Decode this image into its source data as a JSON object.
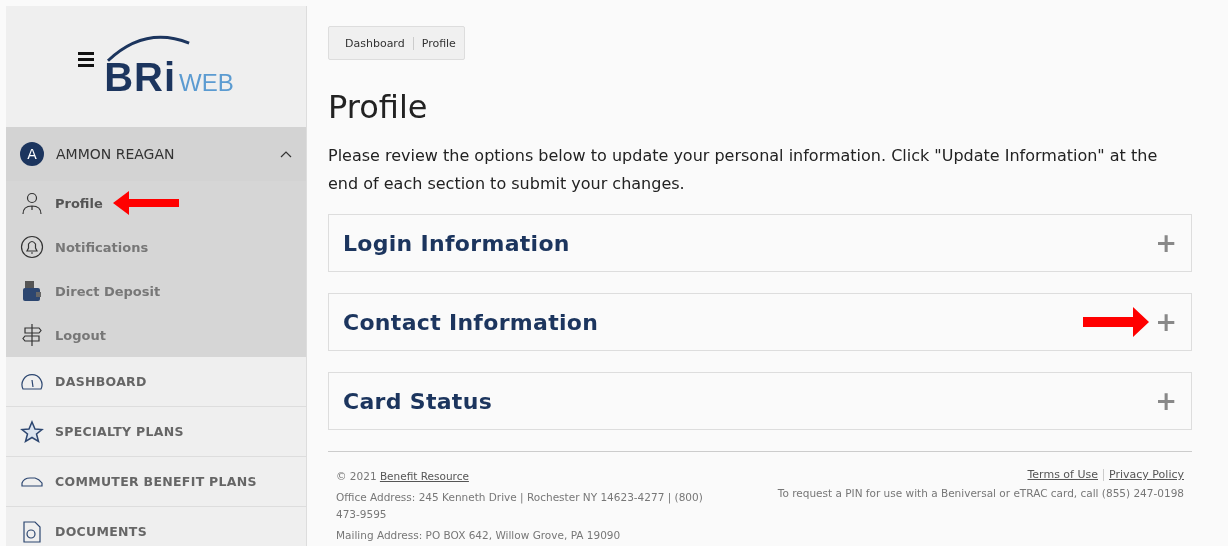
{
  "logo": {
    "main": "BRi",
    "sub": "WEB"
  },
  "user": {
    "initial": "A",
    "name": "AMMON REAGAN",
    "expanded": true
  },
  "user_menu": [
    {
      "label": "Profile",
      "selected": true
    },
    {
      "label": "Notifications",
      "selected": false
    },
    {
      "label": "Direct Deposit",
      "selected": false
    },
    {
      "label": "Logout",
      "selected": false
    }
  ],
  "nav": [
    {
      "label": "DASHBOARD"
    },
    {
      "label": "SPECIALTY PLANS"
    },
    {
      "label": "COMMUTER BENEFIT PLANS"
    },
    {
      "label": "DOCUMENTS"
    }
  ],
  "breadcrumb": [
    "Dashboard",
    "Profile"
  ],
  "title": "Profile",
  "intro": "Please review the options below to update your personal information. Click \"Update Information\" at the end of each section to submit your changes.",
  "sections": [
    {
      "title": "Login Information",
      "icon": "+",
      "expanded": false,
      "marked": false
    },
    {
      "title": "Contact Information",
      "icon": "+",
      "expanded": false,
      "marked": true
    },
    {
      "title": "Card Status",
      "icon": "+",
      "expanded": false,
      "marked": false
    }
  ],
  "footer": {
    "copyright": "© 2021",
    "company": "Benefit Resource",
    "office": "Office Address: 245 Kenneth Drive | Rochester NY 14623-4277 | (800) 473-9595",
    "mailing": "Mailing Address: PO BOX 642, Willow Grove, PA 19090",
    "links": [
      "Terms of Use",
      "Privacy Policy"
    ],
    "pin_note": "To request a PIN for use with a Beniversal or eTRAC card, call (855) 247-0198"
  }
}
